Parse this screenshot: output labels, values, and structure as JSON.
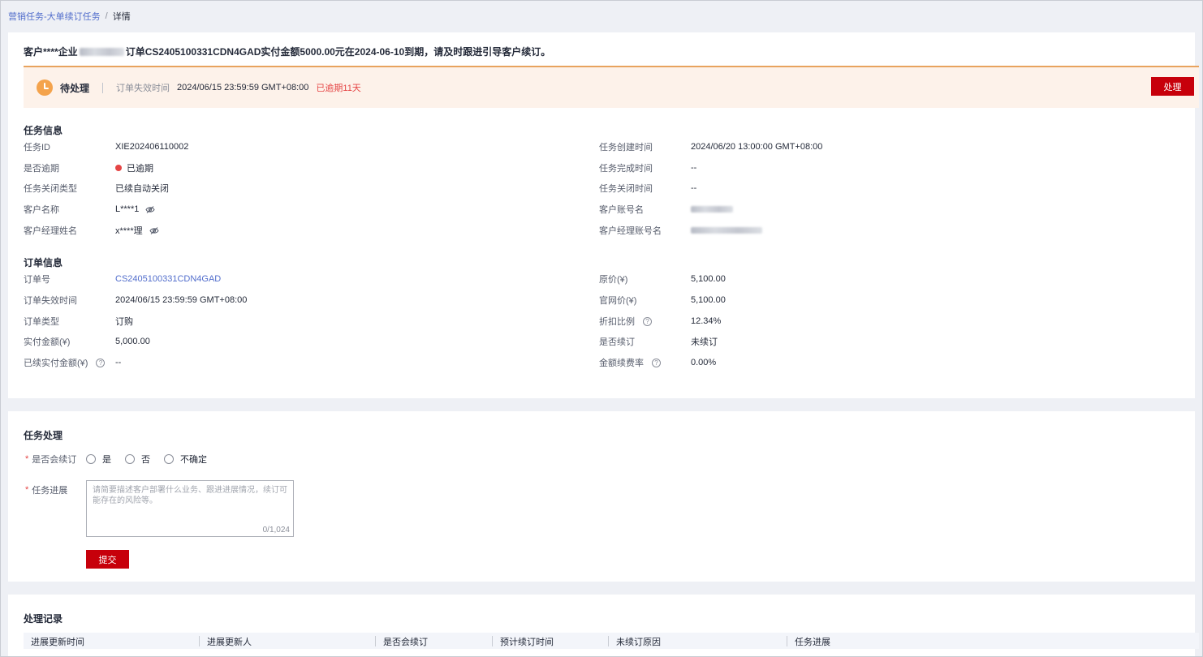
{
  "breadcrumb": {
    "parent": "营销任务-大单续订任务",
    "separator": "/",
    "current": "详情"
  },
  "headline": {
    "prefix": "客户****企业",
    "suffix": "订单CS2405100331CDN4GAD实付金额5000.00元在2024-06-10到期，请及时跟进引导客户续订。"
  },
  "status": {
    "title": "待处理",
    "expire_label": "订单失效时间",
    "expire_value": "2024/06/15 23:59:59 GMT+08:00",
    "overdue_text": "已逾期11天",
    "process_button": "处理"
  },
  "task_info": {
    "title": "任务信息",
    "left": [
      {
        "key": "任务ID",
        "value": "XIE202406110002"
      },
      {
        "key": "是否逾期",
        "value": "已逾期"
      },
      {
        "key": "任务关闭类型",
        "value": "已续自动关闭"
      },
      {
        "key": "客户名称",
        "value": "L****1"
      },
      {
        "key": "客户经理姓名",
        "value": "x****理"
      }
    ],
    "right": [
      {
        "key": "任务创建时间",
        "value": "2024/06/20 13:00:00 GMT+08:00"
      },
      {
        "key": "任务完成时间",
        "value": "--"
      },
      {
        "key": "任务关闭时间",
        "value": "--"
      },
      {
        "key": "客户账号名",
        "value": ""
      },
      {
        "key": "客户经理账号名",
        "value": ""
      }
    ]
  },
  "order_info": {
    "title": "订单信息",
    "left": [
      {
        "key": "订单号",
        "value": "CS2405100331CDN4GAD"
      },
      {
        "key": "订单失效时间",
        "value": "2024/06/15 23:59:59 GMT+08:00"
      },
      {
        "key": "订单类型",
        "value": "订购"
      },
      {
        "key": "实付金额(¥)",
        "value": "5,000.00"
      },
      {
        "key": "已续实付金额(¥)",
        "value": "--"
      }
    ],
    "right": [
      {
        "key": "原价(¥)",
        "value": "5,100.00"
      },
      {
        "key": "官网价(¥)",
        "value": "5,100.00"
      },
      {
        "key": "折扣比例",
        "value": "12.34%"
      },
      {
        "key": "是否续订",
        "value": "未续订"
      },
      {
        "key": "金额续费率",
        "value": "0.00%"
      }
    ]
  },
  "task_process": {
    "title": "任务处理",
    "renew_label": "是否会续订",
    "options": [
      "是",
      "否",
      "不确定"
    ],
    "progress_label": "任务进展",
    "progress_placeholder": "请简要描述客户部署什么业务、跟进进展情况，续订可能存在的风险等。",
    "progress_counter": "0/1,024",
    "submit_button": "提交"
  },
  "records": {
    "title": "处理记录",
    "columns": [
      "进展更新时间",
      "进展更新人",
      "是否会续订",
      "预计续订时间",
      "未续订原因",
      "任务进展"
    ]
  },
  "colors": {
    "accent_red": "#c7000b",
    "link_blue": "#526ecc",
    "status_bg": "#fdf2ea",
    "status_border": "#e8a35e",
    "clock": "#f4a34c"
  },
  "icons": {
    "status": "clock-icon",
    "privacy": "eye-off-icon",
    "help": "question-circle-icon"
  }
}
